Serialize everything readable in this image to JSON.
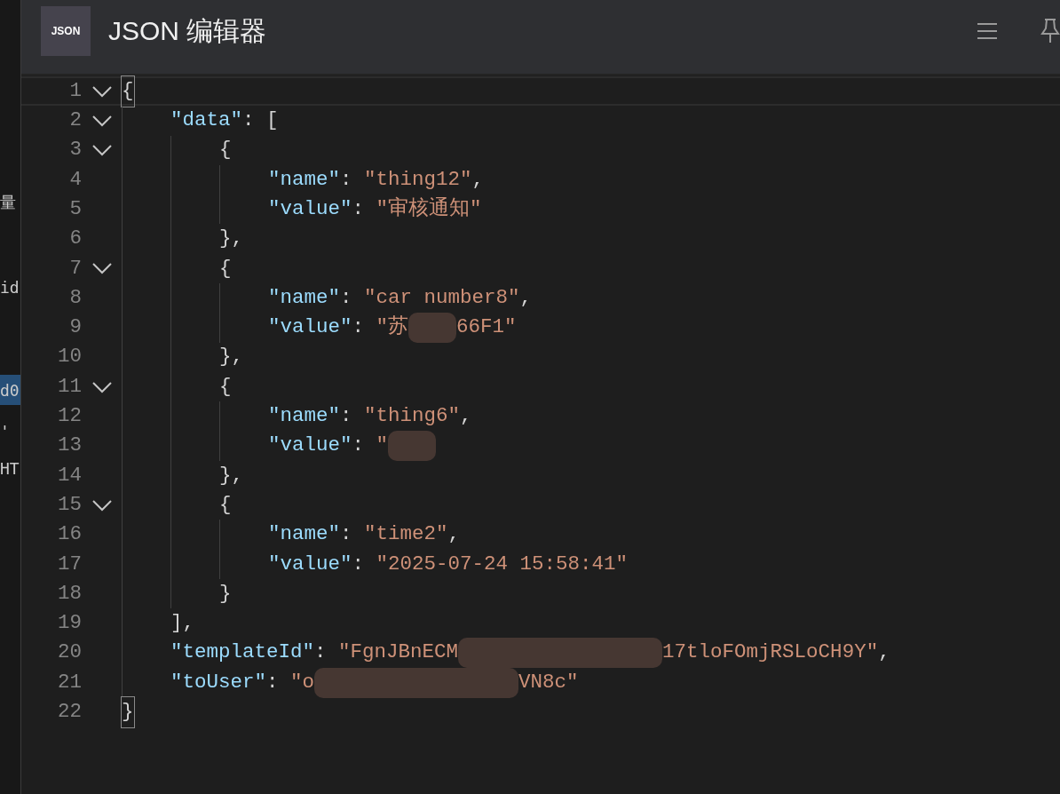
{
  "header": {
    "logo": "JSON",
    "title": "JSON 编辑器"
  },
  "side_fragments": [
    {
      "text": "量",
      "selected": false
    },
    {
      "text": "id",
      "selected": false
    },
    {
      "text": "d0",
      "selected": true
    },
    {
      "text": "'",
      "selected": false
    },
    {
      "text": "HT",
      "selected": false
    }
  ],
  "editor": {
    "lines": [
      {
        "number": "1",
        "foldable": true,
        "current": true,
        "tokens": [
          {
            "kind": "punct",
            "text": "{",
            "highlight": true
          }
        ]
      },
      {
        "number": "2",
        "foldable": true,
        "current": false,
        "tokens": [
          {
            "kind": "key",
            "text": "    \"data\""
          },
          {
            "kind": "punct",
            "text": ": ["
          }
        ]
      },
      {
        "number": "3",
        "foldable": true,
        "current": false,
        "tokens": [
          {
            "kind": "punct",
            "text": "        {"
          }
        ]
      },
      {
        "number": "4",
        "foldable": false,
        "current": false,
        "tokens": [
          {
            "kind": "key",
            "text": "            \"name\""
          },
          {
            "kind": "punct",
            "text": ": "
          },
          {
            "kind": "string",
            "text": "\"thing12\""
          },
          {
            "kind": "punct",
            "text": ","
          }
        ]
      },
      {
        "number": "5",
        "foldable": false,
        "current": false,
        "tokens": [
          {
            "kind": "key",
            "text": "            \"value\""
          },
          {
            "kind": "punct",
            "text": ": "
          },
          {
            "kind": "string",
            "text": "\"审核通知\""
          }
        ]
      },
      {
        "number": "6",
        "foldable": false,
        "current": false,
        "tokens": [
          {
            "kind": "punct",
            "text": "        },"
          }
        ]
      },
      {
        "number": "7",
        "foldable": true,
        "current": false,
        "tokens": [
          {
            "kind": "punct",
            "text": "        {"
          }
        ]
      },
      {
        "number": "8",
        "foldable": false,
        "current": false,
        "tokens": [
          {
            "kind": "key",
            "text": "            \"name\""
          },
          {
            "kind": "punct",
            "text": ": "
          },
          {
            "kind": "string",
            "text": "\"car number8\""
          },
          {
            "kind": "punct",
            "text": ","
          }
        ]
      },
      {
        "number": "9",
        "foldable": false,
        "current": false,
        "tokens": [
          {
            "kind": "key",
            "text": "            \"value\""
          },
          {
            "kind": "punct",
            "text": ": "
          },
          {
            "kind": "string",
            "text": "\"苏"
          },
          {
            "kind": "redacted",
            "wide": false
          },
          {
            "kind": "string",
            "text": "66F1\""
          }
        ]
      },
      {
        "number": "10",
        "foldable": false,
        "current": false,
        "tokens": [
          {
            "kind": "punct",
            "text": "        },"
          }
        ]
      },
      {
        "number": "11",
        "foldable": true,
        "current": false,
        "tokens": [
          {
            "kind": "punct",
            "text": "        {"
          }
        ]
      },
      {
        "number": "12",
        "foldable": false,
        "current": false,
        "tokens": [
          {
            "kind": "key",
            "text": "            \"name\""
          },
          {
            "kind": "punct",
            "text": ": "
          },
          {
            "kind": "string",
            "text": "\"thing6\""
          },
          {
            "kind": "punct",
            "text": ","
          }
        ]
      },
      {
        "number": "13",
        "foldable": false,
        "current": false,
        "tokens": [
          {
            "kind": "key",
            "text": "            \"value\""
          },
          {
            "kind": "punct",
            "text": ": "
          },
          {
            "kind": "string",
            "text": "\""
          },
          {
            "kind": "redacted",
            "wide": false
          }
        ]
      },
      {
        "number": "14",
        "foldable": false,
        "current": false,
        "tokens": [
          {
            "kind": "punct",
            "text": "        },"
          }
        ]
      },
      {
        "number": "15",
        "foldable": true,
        "current": false,
        "tokens": [
          {
            "kind": "punct",
            "text": "        {"
          }
        ]
      },
      {
        "number": "16",
        "foldable": false,
        "current": false,
        "tokens": [
          {
            "kind": "key",
            "text": "            \"name\""
          },
          {
            "kind": "punct",
            "text": ": "
          },
          {
            "kind": "string",
            "text": "\"time2\""
          },
          {
            "kind": "punct",
            "text": ","
          }
        ]
      },
      {
        "number": "17",
        "foldable": false,
        "current": false,
        "tokens": [
          {
            "kind": "key",
            "text": "            \"value\""
          },
          {
            "kind": "punct",
            "text": ": "
          },
          {
            "kind": "string",
            "text": "\"2025-07-24 15:58:41\""
          }
        ]
      },
      {
        "number": "18",
        "foldable": false,
        "current": false,
        "tokens": [
          {
            "kind": "punct",
            "text": "        }"
          }
        ]
      },
      {
        "number": "19",
        "foldable": false,
        "current": false,
        "tokens": [
          {
            "kind": "punct",
            "text": "    ],"
          }
        ]
      },
      {
        "number": "20",
        "foldable": false,
        "current": false,
        "tokens": [
          {
            "kind": "key",
            "text": "    \"templateId\""
          },
          {
            "kind": "punct",
            "text": ": "
          },
          {
            "kind": "string",
            "text": "\"FgnJBnECM"
          },
          {
            "kind": "redacted",
            "wide": true
          },
          {
            "kind": "string",
            "text": "17tloFOmjRSLoCH9Y\""
          },
          {
            "kind": "punct",
            "text": ","
          }
        ]
      },
      {
        "number": "21",
        "foldable": false,
        "current": false,
        "tokens": [
          {
            "kind": "key",
            "text": "    \"toUser\""
          },
          {
            "kind": "punct",
            "text": ": "
          },
          {
            "kind": "string",
            "text": "\"o"
          },
          {
            "kind": "redacted",
            "wide": true
          },
          {
            "kind": "string",
            "text": "VN8c\""
          }
        ]
      },
      {
        "number": "22",
        "foldable": false,
        "current": false,
        "tokens": [
          {
            "kind": "punct",
            "text": "}",
            "highlight": true
          }
        ]
      }
    ]
  }
}
